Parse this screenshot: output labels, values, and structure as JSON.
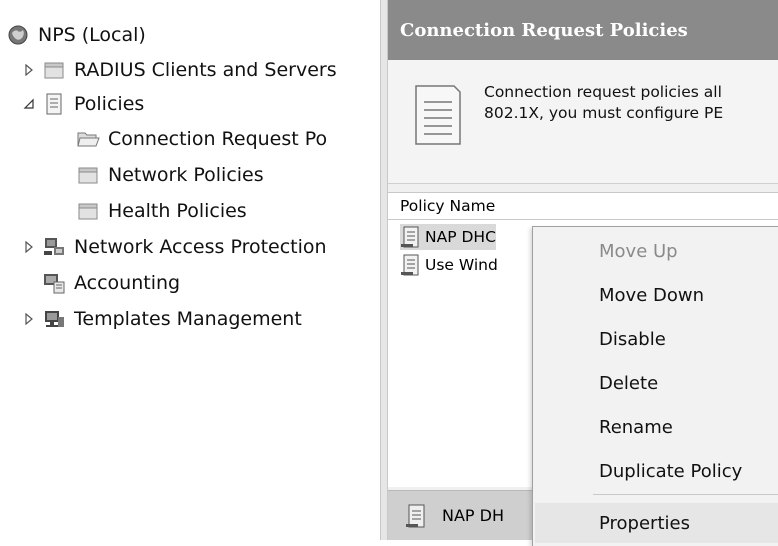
{
  "tree": {
    "root_label": "NPS (Local)",
    "items": [
      {
        "label": "RADIUS Clients and Servers",
        "expander": "collapsed"
      },
      {
        "label": "Policies",
        "expander": "expanded"
      },
      {
        "label": "Connection Request Po",
        "expander": "none"
      },
      {
        "label": "Network Policies",
        "expander": "none"
      },
      {
        "label": "Health Policies",
        "expander": "none"
      },
      {
        "label": "Network Access Protection",
        "expander": "collapsed"
      },
      {
        "label": "Accounting",
        "expander": "none"
      },
      {
        "label": "Templates Management",
        "expander": "collapsed"
      }
    ]
  },
  "right_pane": {
    "title": "Connection Request Policies",
    "description_line1": "Connection request policies all",
    "description_line2": "802.1X, you must configure PE",
    "list_header": "Policy Name",
    "rows": [
      "NAP DHC",
      "Use Wind"
    ],
    "detail_bar_label": "NAP DH"
  },
  "context_menu": {
    "items": [
      {
        "label": "Move Up",
        "enabled": false
      },
      {
        "label": "Move Down",
        "enabled": true
      },
      {
        "label": "Disable",
        "enabled": true
      },
      {
        "label": "Delete",
        "enabled": true
      },
      {
        "label": "Rename",
        "enabled": true
      },
      {
        "label": "Duplicate Policy",
        "enabled": true
      },
      {
        "label": "Properties",
        "enabled": true
      }
    ]
  },
  "colors": {
    "title_bar": "#8a8a8a",
    "selection": "#d9d9d9",
    "disabled_text": "#8a8a8a"
  }
}
